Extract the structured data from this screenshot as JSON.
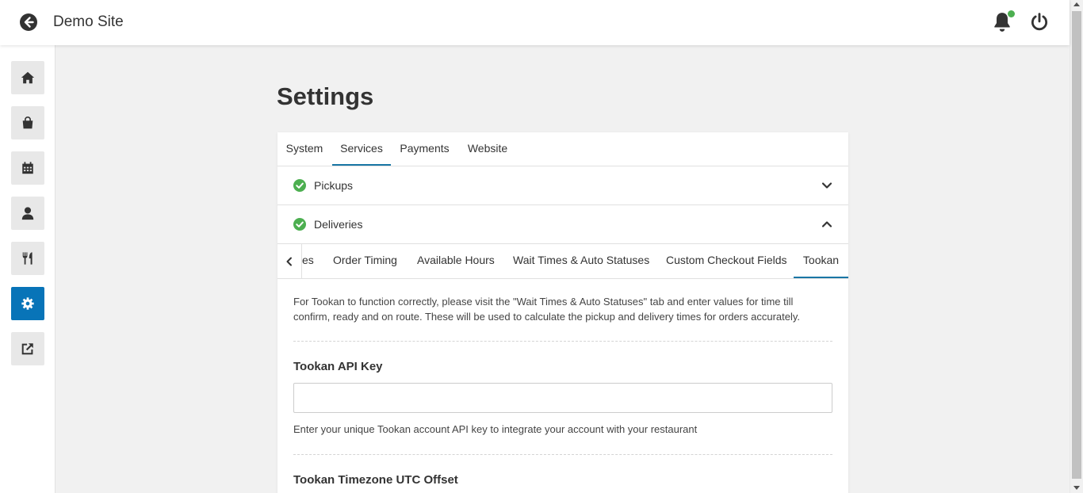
{
  "header": {
    "title": "Demo Site"
  },
  "page": {
    "title": "Settings"
  },
  "tabs": [
    {
      "label": "System",
      "active": false
    },
    {
      "label": "Services",
      "active": true
    },
    {
      "label": "Payments",
      "active": false
    },
    {
      "label": "Website",
      "active": false
    }
  ],
  "accordion": [
    {
      "label": "Pickups",
      "status": "enabled",
      "expanded": false
    },
    {
      "label": "Deliveries",
      "status": "enabled",
      "expanded": true
    }
  ],
  "subtabs": [
    {
      "label": "es",
      "active": false
    },
    {
      "label": "Order Timing",
      "active": false
    },
    {
      "label": "Available Hours",
      "active": false
    },
    {
      "label": "Wait Times & Auto Statuses",
      "active": false
    },
    {
      "label": "Custom Checkout Fields",
      "active": false
    },
    {
      "label": "Tookan",
      "active": true
    }
  ],
  "tookan": {
    "notice": "For Tookan to function correctly, please visit the \"Wait Times & Auto Statuses\" tab and enter values for time till confirm, ready and on route. These will be used to calculate the pickup and delivery times for orders accurately.",
    "api_key_label": "Tookan API Key",
    "api_key_value": "",
    "api_key_help": "Enter your unique Tookan account API key to integrate your account with your restaurant",
    "timezone_label": "Tookan Timezone UTC Offset"
  },
  "sidebar_icons": [
    "home-icon",
    "shopping-bag-icon",
    "calendar-icon",
    "user-icon",
    "utensils-icon",
    "gear-icon",
    "external-link-icon"
  ],
  "colors": {
    "accent": "#0874b8",
    "success": "#4caf50",
    "notification_dot": "#4caf50"
  }
}
